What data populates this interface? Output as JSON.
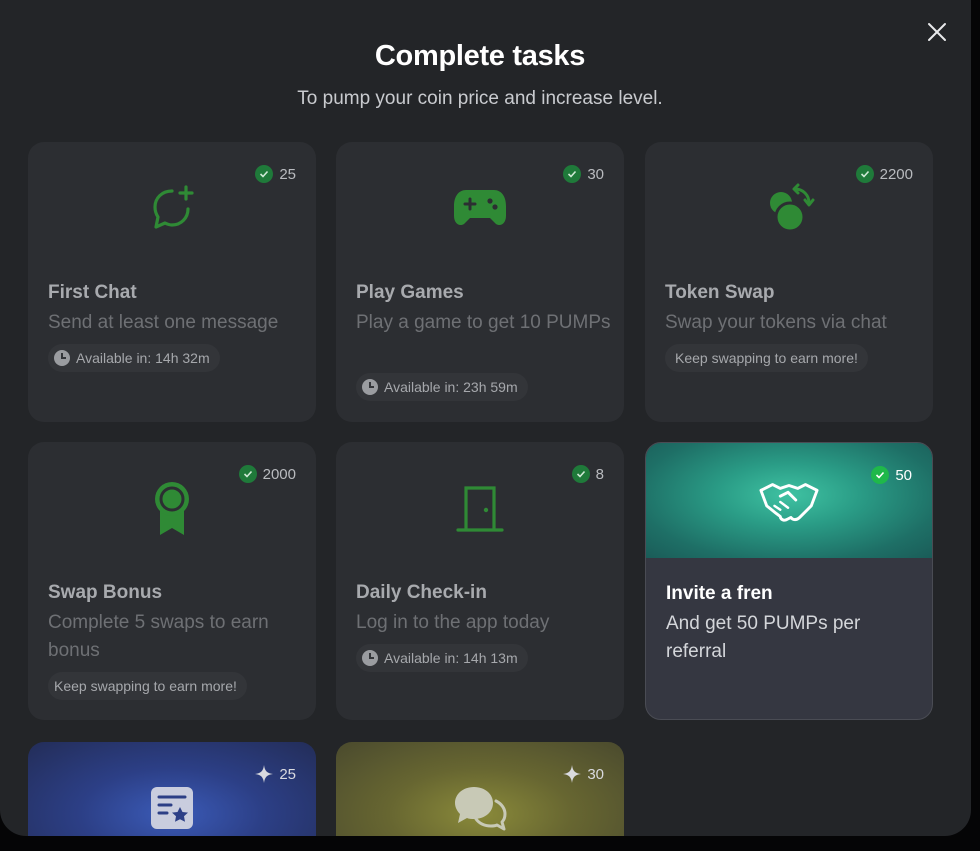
{
  "modal": {
    "title": "Complete tasks",
    "subtitle": "To pump your coin price and increase level."
  },
  "tasks": [
    {
      "title": "First Chat",
      "description": "Send at least one message",
      "reward": "25",
      "status_icon": "check-circle-icon",
      "icon": "chat-add-icon",
      "pill": "Available in: 14h 32m"
    },
    {
      "title": "Play Games",
      "description": "Play a game to get 10 PUMPs",
      "reward": "30",
      "status_icon": "check-circle-icon",
      "icon": "gamepad-icon",
      "pill": "Available in: 23h 59m"
    },
    {
      "title": "Token Swap",
      "description": "Swap your tokens via chat",
      "reward": "2200",
      "status_icon": "check-circle-icon",
      "icon": "swap-coins-icon",
      "pill": "Keep swapping to earn more!"
    },
    {
      "title": "Swap Bonus",
      "description": "Complete 5 swaps to earn bonus",
      "reward": "2000",
      "status_icon": "check-circle-icon",
      "icon": "award-ribbon-icon",
      "pill": "Keep swapping to earn more!"
    },
    {
      "title": "Daily Check-in",
      "description": "Log in to the app today",
      "reward": "8",
      "status_icon": "check-circle-icon",
      "icon": "door-icon",
      "pill": "Available in: 14h 13m"
    },
    {
      "title": "Invite a fren",
      "description": "And get 50 PUMPs per referral",
      "reward": "50",
      "status_icon": "check-circle-icon",
      "icon": "handshake-icon"
    },
    {
      "reward": "25",
      "status_icon": "sparkle-icon",
      "icon": "review-star-icon"
    },
    {
      "reward": "30",
      "status_icon": "sparkle-icon",
      "icon": "chat-bubbles-icon"
    }
  ],
  "colors": {
    "background": "#232528",
    "card": "#2c2e32",
    "completed_icon": "#2f8a35",
    "invite_accent": "#2a9c86",
    "blue_card": "#2c3f86",
    "yellow_card": "#676631"
  }
}
